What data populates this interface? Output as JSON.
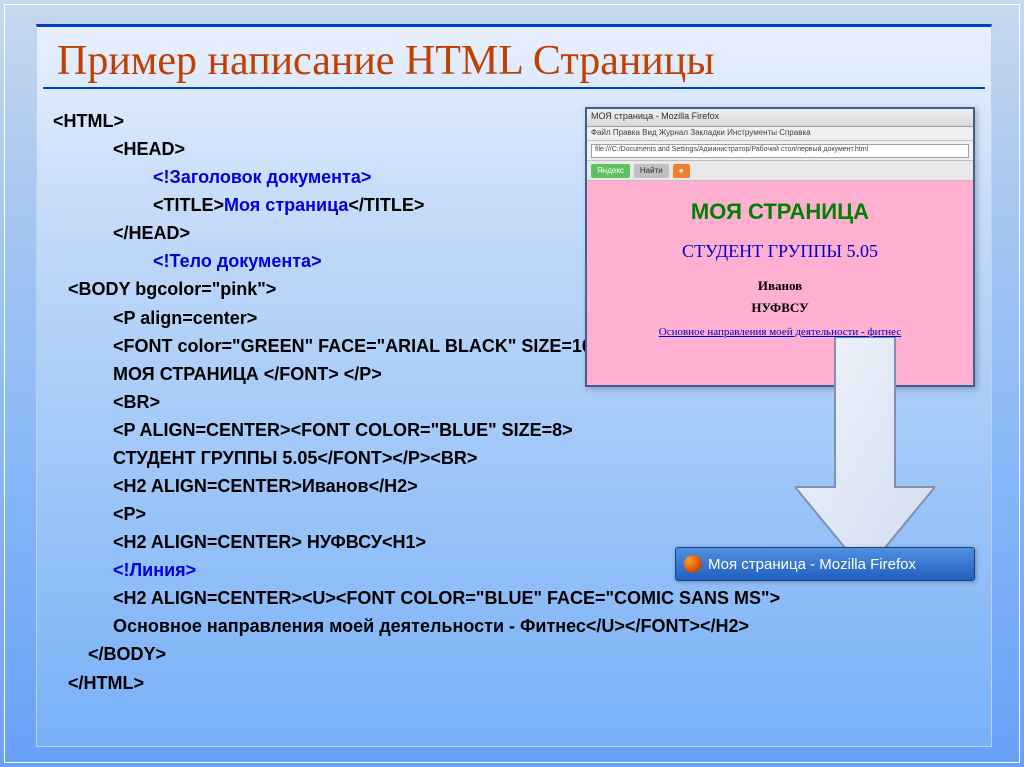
{
  "title": "Пример написание HTML Страницы",
  "code": {
    "l01": "<HTML>",
    "l02": "<HEAD>",
    "l03": "<!Заголовок документа>",
    "l04a": "<TITLE>",
    "l04b": "Моя страница",
    "l04c": "</TITLE>",
    "l05": "</HEAD>",
    "l06": "<!Тело документа>",
    "l07": "<BODY bgcolor=\"pink\">",
    "l08": "<P align=center>",
    "l09": "<FONT color=\"GREEN\" FACE=\"ARIAL BLACK\" SIZE=10>",
    "l10": "МОЯ СТРАНИЦА </FONT> </P>",
    "l11": "<BR>",
    "l12": "<P ALIGN=CENTER><FONT COLOR=\"BLUE\" SIZE=8>",
    "l13": "СТУДЕНТ ГРУППЫ 5.05</FONT></P><BR>",
    "l14": "<H2 ALIGN=CENTER>Иванов</H2>",
    "l15": "<P>",
    "l16": "<H2 ALIGN=CENTER> НУФВСУ<H1>",
    "l17": "<!Линия>",
    "l18": "<H2 ALIGN=CENTER><U><FONT COLOR=\"BLUE\" FACE=\"COMIC SANS MS\">",
    "l19": "Основное направления моей деятельности - Фитнес</U></FONT></H2>",
    "l20": "</BODY>",
    "l21": "</HTML>"
  },
  "browser": {
    "title": "МОЯ страница - Mozilla Firefox",
    "menubar": "Файл  Правка  Вид  Журнал  Закладки  Инструменты  Справка",
    "addr": "file:///C:/Documents and Settings/Администратор/Рабочий стол/первый документ.html",
    "view": {
      "h1": "МОЯ СТРАНИЦА",
      "h2": "СТУДЕНТ ГРУППЫ 5.05",
      "h3a": "Иванов",
      "h3b": "НУФВСУ",
      "link": "Основное направления моей деятельности  -  фитнес"
    }
  },
  "taskbtn": "Моя страница - Mozilla Firefox"
}
